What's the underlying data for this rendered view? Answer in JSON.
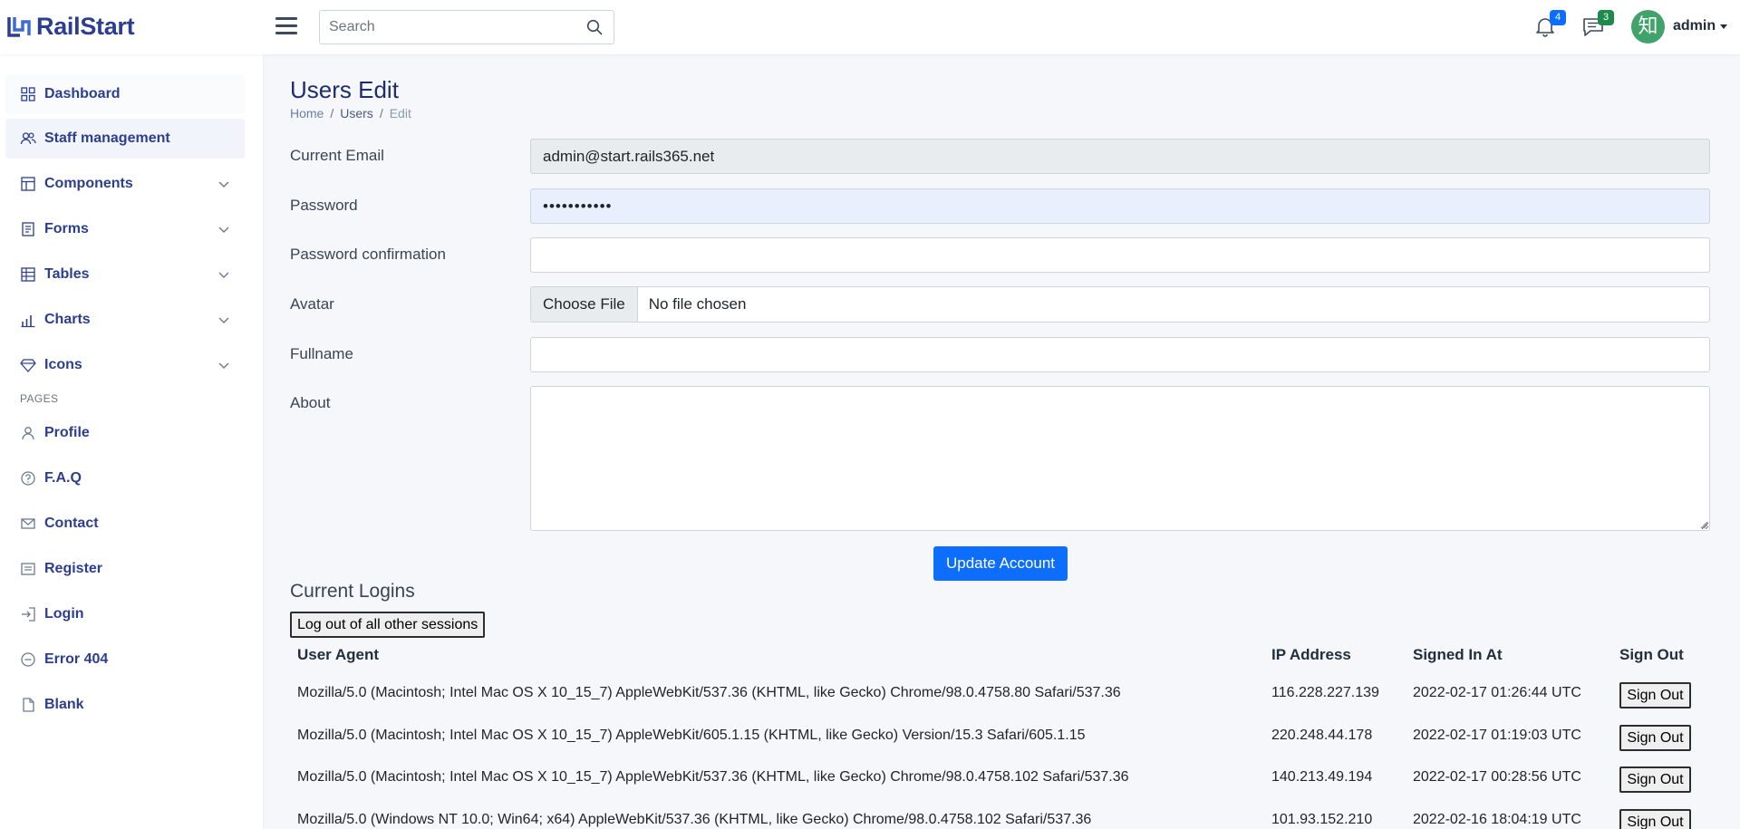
{
  "brand": {
    "name": "RailStart",
    "color": "#2c3e8f"
  },
  "header": {
    "search_placeholder": "Search",
    "notifications_count": "4",
    "messages_count": "3",
    "avatar_glyph": "知",
    "username": "admin"
  },
  "sidebar": {
    "items": [
      {
        "label": "Dashboard",
        "icon": "grid-icon"
      },
      {
        "label": "Staff management",
        "icon": "users-icon"
      },
      {
        "label": "Components",
        "icon": "layout-icon"
      },
      {
        "label": "Forms",
        "icon": "clipboard-icon"
      },
      {
        "label": "Tables",
        "icon": "table-icon"
      },
      {
        "label": "Charts",
        "icon": "bar-chart-icon"
      },
      {
        "label": "Icons",
        "icon": "diamond-icon"
      }
    ],
    "pages_heading": "PAGES",
    "pages": [
      {
        "label": "Profile",
        "icon": "user-icon"
      },
      {
        "label": "F.A.Q",
        "icon": "help-circle-icon"
      },
      {
        "label": "Contact",
        "icon": "mail-icon"
      },
      {
        "label": "Register",
        "icon": "list-icon"
      },
      {
        "label": "Login",
        "icon": "login-icon"
      },
      {
        "label": "Error 404",
        "icon": "minus-circle-icon"
      },
      {
        "label": "Blank",
        "icon": "file-icon"
      }
    ]
  },
  "page": {
    "title": "Users Edit",
    "breadcrumb": [
      "Home",
      "Users",
      "Edit"
    ]
  },
  "form": {
    "current_email_label": "Current Email",
    "current_email_value": "admin@start.rails365.net",
    "password_label": "Password",
    "password_value": "•••••••••••",
    "password_confirmation_label": "Password confirmation",
    "avatar_label": "Avatar",
    "choose_file": "Choose File",
    "no_file": "No file chosen",
    "fullname_label": "Fullname",
    "about_label": "About",
    "submit_label": "Update Account"
  },
  "logins": {
    "title": "Current Logins",
    "logout_all_label": "Log out of all other sessions",
    "headers": [
      "User Agent",
      "IP Address",
      "Signed In At",
      "Sign Out"
    ],
    "rows": [
      {
        "agent": "Mozilla/5.0 (Macintosh; Intel Mac OS X 10_15_7) AppleWebKit/537.36 (KHTML, like Gecko) Chrome/98.0.4758.80 Safari/537.36",
        "ip": "116.228.227.139",
        "signed_in": "2022-02-17 01:26:44 UTC",
        "action": "Sign Out"
      },
      {
        "agent": "Mozilla/5.0 (Macintosh; Intel Mac OS X 10_15_7) AppleWebKit/605.1.15 (KHTML, like Gecko) Version/15.3 Safari/605.1.15",
        "ip": "220.248.44.178",
        "signed_in": "2022-02-17 01:19:03 UTC",
        "action": "Sign Out"
      },
      {
        "agent": "Mozilla/5.0 (Macintosh; Intel Mac OS X 10_15_7) AppleWebKit/537.36 (KHTML, like Gecko) Chrome/98.0.4758.102 Safari/537.36",
        "ip": "140.213.49.194",
        "signed_in": "2022-02-17 00:28:56 UTC",
        "action": "Sign Out"
      },
      {
        "agent": "Mozilla/5.0 (Windows NT 10.0; Win64; x64) AppleWebKit/537.36 (KHTML, like Gecko) Chrome/98.0.4758.102 Safari/537.36",
        "ip": "101.93.152.210",
        "signed_in": "2022-02-16 18:04:19 UTC",
        "action": "Sign Out"
      }
    ]
  },
  "colors": {
    "primary": "#0d6efd",
    "notification_badge": "#0d6efd",
    "message_badge": "#1e8a4c",
    "avatar_bg": "#3fa36a"
  }
}
